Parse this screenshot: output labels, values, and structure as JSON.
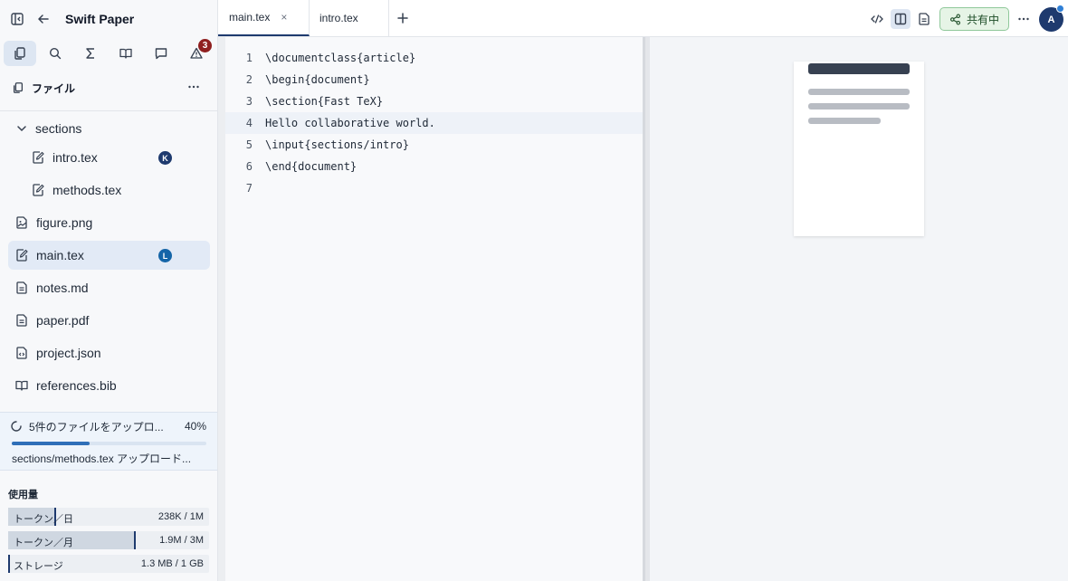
{
  "app": {
    "title": "Swift Paper"
  },
  "sidebar": {
    "tabs": [
      {
        "name": "files",
        "active": true
      },
      {
        "name": "search"
      },
      {
        "name": "symbols"
      },
      {
        "name": "references"
      },
      {
        "name": "comments"
      },
      {
        "name": "issues",
        "badge": "3"
      }
    ],
    "files_title": "ファイル",
    "tree": [
      {
        "label": "sections",
        "type": "folder",
        "expanded": true
      },
      {
        "label": "intro.tex",
        "type": "tex",
        "user": "K",
        "user_color": "#1e3a6e"
      },
      {
        "label": "methods.tex",
        "type": "tex"
      },
      {
        "label": "figure.png",
        "type": "image"
      },
      {
        "label": "main.tex",
        "type": "tex",
        "selected": true,
        "user": "L",
        "user_color": "#1565a8"
      },
      {
        "label": "notes.md",
        "type": "doc"
      },
      {
        "label": "paper.pdf",
        "type": "doc"
      },
      {
        "label": "project.json",
        "type": "json"
      },
      {
        "label": "references.bib",
        "type": "bib"
      }
    ],
    "upload": {
      "text": "5件のファイルをアップロ...",
      "percent_label": "40%",
      "progress": 0.4,
      "file": "sections/methods.tex アップロード..."
    },
    "usage": {
      "title": "使用量",
      "rows": [
        {
          "label": "トークン／日",
          "value": "238K / 1M",
          "fraction": 0.238
        },
        {
          "label": "トークン／月",
          "value": "1.9M / 3M",
          "fraction": 0.633
        },
        {
          "label": "ストレージ",
          "value": "1.3 MB / 1 GB",
          "fraction": 0.0013
        }
      ]
    }
  },
  "tabs": [
    {
      "label": "main.tex",
      "active": true,
      "close": "×"
    },
    {
      "label": "intro.tex"
    }
  ],
  "toolbar": {
    "share_label": "共有中",
    "user_initial": "A",
    "colors": {
      "accent": "#1e3a6e",
      "share_bg": "#e6f4e6",
      "share_border": "#8fc89a"
    }
  },
  "editor": {
    "highlight_line": 4,
    "lines": [
      {
        "n": "1",
        "text": "\\documentclass{article}"
      },
      {
        "n": "2",
        "text": "\\begin{document}"
      },
      {
        "n": "3",
        "text": "\\section{Fast TeX}"
      },
      {
        "n": "4",
        "text": "Hello collaborative world."
      },
      {
        "n": "5",
        "text": "\\input{sections/intro}"
      },
      {
        "n": "6",
        "text": "\\end{document}"
      },
      {
        "n": "7",
        "text": ""
      }
    ]
  }
}
